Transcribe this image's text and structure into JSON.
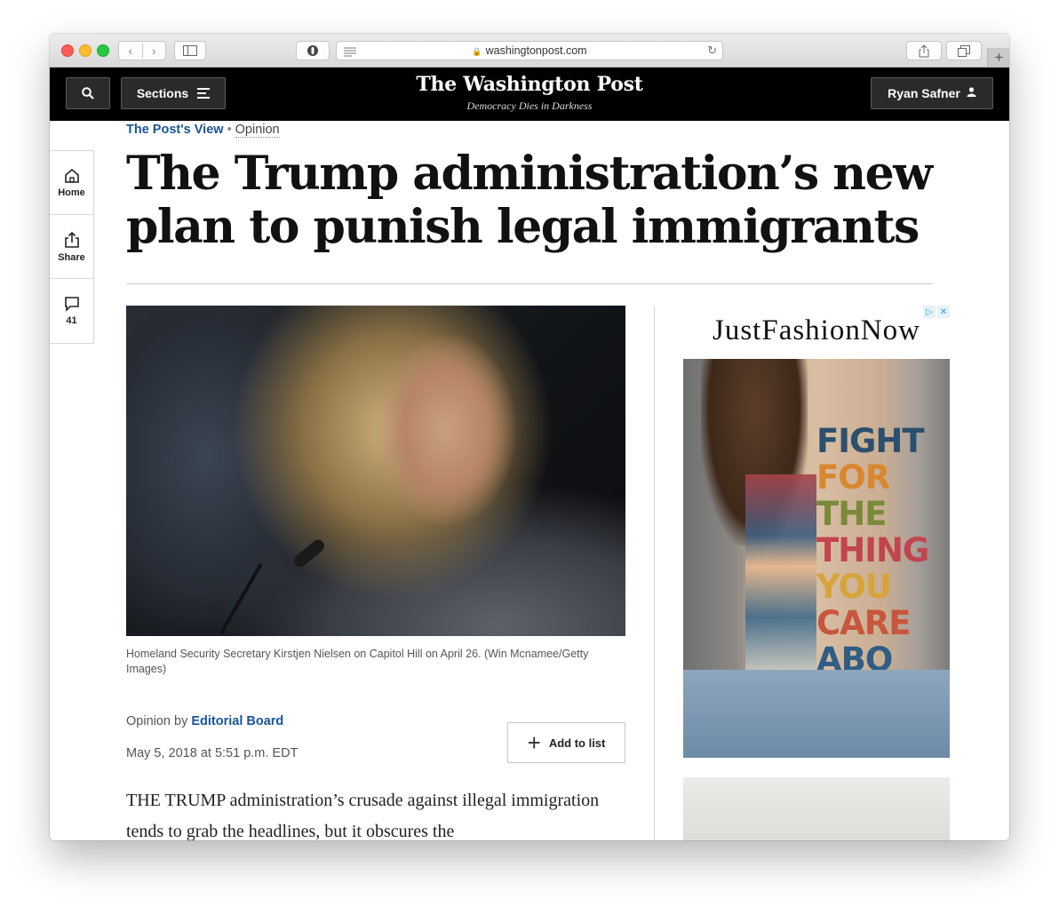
{
  "browser": {
    "url": "washingtonpost.com"
  },
  "header": {
    "logo": "The Washington Post",
    "tagline": "Democracy Dies in Darkness",
    "sections_label": "Sections",
    "user_name": "Ryan Safner"
  },
  "rail": {
    "home_label": "Home",
    "share_label": "Share",
    "comments_count": "41"
  },
  "article": {
    "kicker_section": "The Post's View",
    "kicker_label": "Opinion",
    "headline": "The Trump administration’s new plan to punish legal immigrants",
    "caption": "Homeland Security Secretary Kirstjen Nielsen on Capitol Hill on April 26. (Win Mcnamee/Getty Images)",
    "byline_prefix": "Opinion by",
    "byline_author": "Editorial Board",
    "date": "May 5, 2018 at 5:51 p.m. EDT",
    "add_to_list_label": "Add to list",
    "body_preview": "THE TRUMP administration’s crusade against illegal immigration tends to grab the headlines, but it obscures the"
  },
  "ad": {
    "brand": "JustFashionNow",
    "slogan": [
      {
        "text": "FIGHT",
        "color": "#2c4f6e"
      },
      {
        "text": "FOR",
        "color": "#d9872e"
      },
      {
        "text": "THE",
        "color": "#7a8a3a"
      },
      {
        "text": "THING",
        "color": "#c2444e"
      },
      {
        "text": "YOU",
        "color": "#d6a43a"
      },
      {
        "text": "CARE",
        "color": "#c8553d"
      },
      {
        "text": "ABO",
        "color": "#2e5d86"
      }
    ]
  }
}
